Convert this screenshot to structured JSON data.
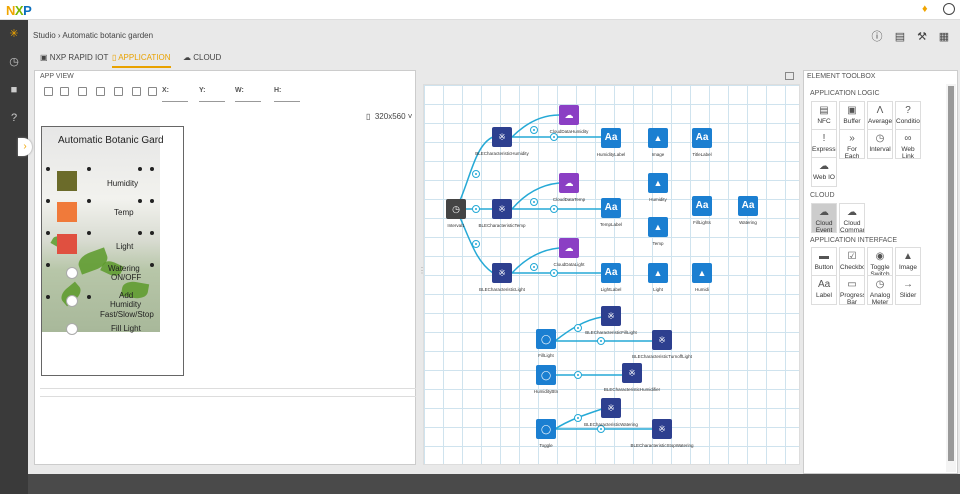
{
  "app": {
    "logo_n": "N",
    "logo_x": "X",
    "logo_p": "P"
  },
  "breadcrumb": "Studio ›  Automatic botanic garden",
  "tabs": [
    {
      "label": "NXP RAPID IOT",
      "icon": "chip-icon"
    },
    {
      "label": "APPLICATION",
      "icon": "app-icon",
      "active": true
    },
    {
      "label": "CLOUD",
      "icon": "cloud-icon"
    }
  ],
  "app_view": {
    "title": "APP VIEW",
    "fields": {
      "x": "X:",
      "y": "Y:",
      "w": "W:",
      "h": "H:"
    },
    "device_size": "320x560"
  },
  "phone": {
    "title": "Automatic Botanic Gard",
    "labels": [
      "Humidity",
      "Temp",
      "Light",
      "Watering",
      "ON/OFF",
      "Add",
      "Humidity",
      "Fast/Slow/Stop",
      "Fill Light"
    ]
  },
  "toolbox": {
    "title": "ELEMENT TOOLBOX",
    "sections": [
      {
        "title": "APPLICATION LOGIC",
        "items": [
          "NFC",
          "Buffer",
          "Average",
          "Condition",
          "Expression",
          "For Each",
          "Interval",
          "Web Link",
          "Web IO"
        ]
      },
      {
        "title": "CLOUD",
        "items": [
          "Cloud Event",
          "Cloud Command"
        ]
      },
      {
        "title": "APPLICATION INTERFACE",
        "items": [
          "Button",
          "Checkbox",
          "Toggle Switch",
          "Image",
          "Label",
          "Progress Bar",
          "Analog Meter",
          "Slider"
        ]
      }
    ]
  },
  "canvas_nodes": {
    "interval": "Interval1",
    "ble_humidity": "BLECharacteristicHumidity",
    "ble_temp": "BLECharacteristicTemp",
    "ble_light": "BLECharacteristicLight",
    "cloud_humidity": "CloudDataHumidity",
    "cloud_temp": "CloudDataTemp",
    "cloud_light": "CloudDataLight",
    "humidity_label": "HumidityLabel",
    "temp_label": "TempLabel",
    "light_label": "LightLabel",
    "image": "Image",
    "humidity": "Humidity",
    "temp": "Temp",
    "light": "Light",
    "humidi": "Humidi",
    "title_label": "TitleLabel",
    "fill_lights": "FillLights",
    "watering": "Watering",
    "fill_light": "FillLight",
    "ble_fill_light": "BLECharacteristicFillLight",
    "ble_turn_off_light": "BLECharacteristicTurnoffLight",
    "humidity_button": "HumidityBtn",
    "ble_humidifier": "BLECharacteristicHumidifier",
    "toggle": "Toggle",
    "ble_watering": "BLECharacteristicWatering",
    "ble_stop_watering": "BLECharacteristicStopWatering"
  }
}
